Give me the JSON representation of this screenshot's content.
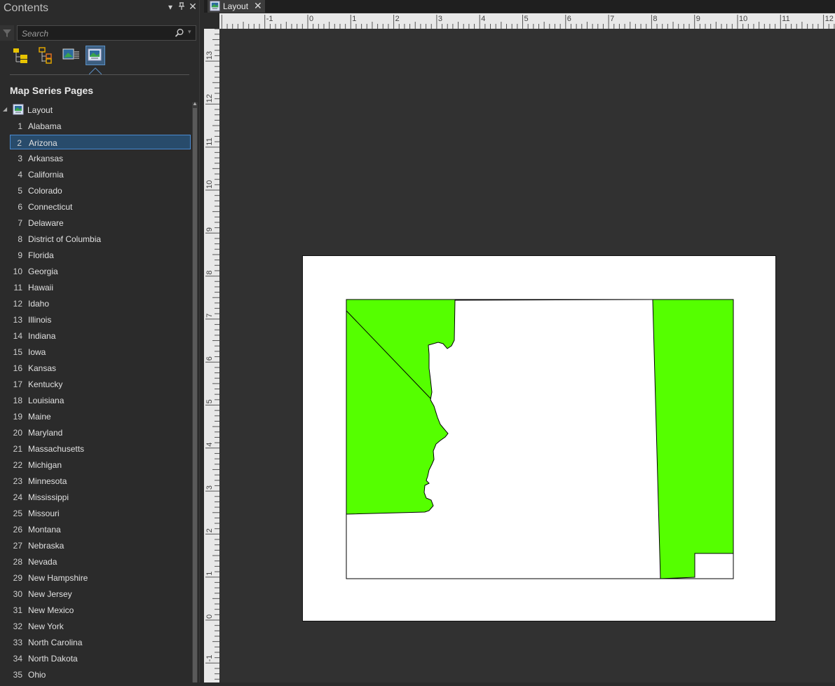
{
  "contents_pane": {
    "title": "Contents",
    "search_placeholder": "Search",
    "section_title": "Map Series Pages",
    "root_label": "Layout",
    "pages": [
      {
        "num": "1",
        "name": "Alabama"
      },
      {
        "num": "2",
        "name": "Arizona",
        "selected": true
      },
      {
        "num": "3",
        "name": "Arkansas"
      },
      {
        "num": "4",
        "name": "California"
      },
      {
        "num": "5",
        "name": "Colorado"
      },
      {
        "num": "6",
        "name": "Connecticut"
      },
      {
        "num": "7",
        "name": "Delaware"
      },
      {
        "num": "8",
        "name": "District of Columbia"
      },
      {
        "num": "9",
        "name": "Florida"
      },
      {
        "num": "10",
        "name": "Georgia"
      },
      {
        "num": "11",
        "name": "Hawaii"
      },
      {
        "num": "12",
        "name": "Idaho"
      },
      {
        "num": "13",
        "name": "Illinois"
      },
      {
        "num": "14",
        "name": "Indiana"
      },
      {
        "num": "15",
        "name": "Iowa"
      },
      {
        "num": "16",
        "name": "Kansas"
      },
      {
        "num": "17",
        "name": "Kentucky"
      },
      {
        "num": "18",
        "name": "Louisiana"
      },
      {
        "num": "19",
        "name": "Maine"
      },
      {
        "num": "20",
        "name": "Maryland"
      },
      {
        "num": "21",
        "name": "Massachusetts"
      },
      {
        "num": "22",
        "name": "Michigan"
      },
      {
        "num": "23",
        "name": "Minnesota"
      },
      {
        "num": "24",
        "name": "Mississippi"
      },
      {
        "num": "25",
        "name": "Missouri"
      },
      {
        "num": "26",
        "name": "Montana"
      },
      {
        "num": "27",
        "name": "Nebraska"
      },
      {
        "num": "28",
        "name": "Nevada"
      },
      {
        "num": "29",
        "name": "New Hampshire"
      },
      {
        "num": "30",
        "name": "New Jersey"
      },
      {
        "num": "31",
        "name": "New Mexico"
      },
      {
        "num": "32",
        "name": "New York"
      },
      {
        "num": "33",
        "name": "North Carolina"
      },
      {
        "num": "34",
        "name": "North Dakota"
      },
      {
        "num": "35",
        "name": "Ohio"
      }
    ],
    "view_buttons": [
      "list-by-drawing-order-icon",
      "list-by-source-icon",
      "list-by-type-icon",
      "map-series-pages-icon"
    ]
  },
  "layout_tab": {
    "label": "Layout",
    "close": "✕"
  },
  "rulers": {
    "horizontal_labels": [
      "-1",
      "0",
      "1",
      "2",
      "3",
      "4",
      "5",
      "6",
      "7",
      "8",
      "9",
      "10",
      "11",
      "12"
    ],
    "vertical_labels": [
      "13",
      "12",
      "11",
      "10",
      "9",
      "8",
      "7",
      "6",
      "5",
      "4",
      "3",
      "2",
      "1",
      "0",
      "-1"
    ]
  },
  "map": {
    "fill_color": "#55ff00",
    "stroke_color": "#000000"
  }
}
